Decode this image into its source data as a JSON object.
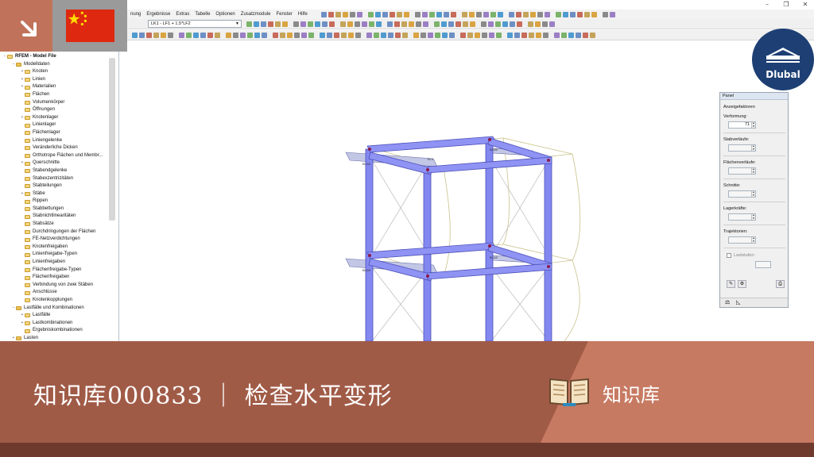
{
  "window": {
    "controls": [
      "–",
      "❐",
      "✕"
    ]
  },
  "menu": {
    "items": [
      "nung",
      "Ergebnisse",
      "Extras",
      "Tabelle",
      "Optionen",
      "Zusatzmodule",
      "Fenster",
      "Hilfe"
    ]
  },
  "toolbar": {
    "load_combo_value": "LK1 - LF1 + 1.5*LF2"
  },
  "navigator": {
    "root": "RFEM - Model File",
    "items": [
      {
        "label": "Modelldaten",
        "level": 1,
        "expand": "−"
      },
      {
        "label": "Knoten",
        "level": 2,
        "expand": "+"
      },
      {
        "label": "Linien",
        "level": 2,
        "expand": "+"
      },
      {
        "label": "Materialien",
        "level": 2,
        "expand": "+"
      },
      {
        "label": "Flächen",
        "level": 2,
        "expand": ""
      },
      {
        "label": "Volumenkörper",
        "level": 2,
        "expand": ""
      },
      {
        "label": "Öffnungen",
        "level": 2,
        "expand": ""
      },
      {
        "label": "Knotenlager",
        "level": 2,
        "expand": "+"
      },
      {
        "label": "Linienlager",
        "level": 2,
        "expand": ""
      },
      {
        "label": "Flächenlager",
        "level": 2,
        "expand": ""
      },
      {
        "label": "Liniengelenke",
        "level": 2,
        "expand": ""
      },
      {
        "label": "Veränderliche Dicken",
        "level": 2,
        "expand": ""
      },
      {
        "label": "Orthotrope Flächen und Membr...",
        "level": 2,
        "expand": ""
      },
      {
        "label": "Querschnitte",
        "level": 2,
        "expand": "+"
      },
      {
        "label": "Stabendgelenke",
        "level": 2,
        "expand": ""
      },
      {
        "label": "Stabexzentrizitäten",
        "level": 2,
        "expand": ""
      },
      {
        "label": "Stabteilungen",
        "level": 2,
        "expand": ""
      },
      {
        "label": "Stäbe",
        "level": 2,
        "expand": "+"
      },
      {
        "label": "Rippen",
        "level": 2,
        "expand": ""
      },
      {
        "label": "Stabbettungen",
        "level": 2,
        "expand": ""
      },
      {
        "label": "Stabnichtlinearitäten",
        "level": 2,
        "expand": ""
      },
      {
        "label": "Stabsätze",
        "level": 2,
        "expand": ""
      },
      {
        "label": "Durchdringungen der Flächen",
        "level": 2,
        "expand": ""
      },
      {
        "label": "FE-Netzverdichtungen",
        "level": 2,
        "expand": ""
      },
      {
        "label": "Knotenfreigaben",
        "level": 2,
        "expand": ""
      },
      {
        "label": "Linienfreigabe-Typen",
        "level": 2,
        "expand": ""
      },
      {
        "label": "Linienfreigaben",
        "level": 2,
        "expand": ""
      },
      {
        "label": "Flächenfreigabe-Typen",
        "level": 2,
        "expand": ""
      },
      {
        "label": "Flächenfreigaben",
        "level": 2,
        "expand": ""
      },
      {
        "label": "Verbindung von zwei Stäben",
        "level": 2,
        "expand": ""
      },
      {
        "label": "Anschlüsse",
        "level": 2,
        "expand": ""
      },
      {
        "label": "Knotenkopplungen",
        "level": 2,
        "expand": ""
      },
      {
        "label": "Lastfälle und Kombinationen",
        "level": 1,
        "expand": "−"
      },
      {
        "label": "Lastfälle",
        "level": 2,
        "expand": "+"
      },
      {
        "label": "Lastkombinationen",
        "level": 2,
        "expand": "+"
      },
      {
        "label": "Ergebniskombinationen",
        "level": 2,
        "expand": ""
      },
      {
        "label": "Lasten",
        "level": 1,
        "expand": "+"
      }
    ]
  },
  "panel": {
    "title": "Panel",
    "section": "Anzeigefaktoren",
    "deformation_label": "Verformung:",
    "deformation_value": "71",
    "stab_label": "Stabverläufe:",
    "flaechen_label": "Flächenverläufe:",
    "schnitte_label": "Schnitte:",
    "lager_label": "Lagerkräfte:",
    "trajektorien_label": "Trajektorien:",
    "laststufen_label": "Laststufen:"
  },
  "model": {
    "annotation_top": "Bl.4",
    "node_labels": [
      "Bl.4/0",
      "Bl.4/0",
      "Bl.4/0",
      "Bl.4/0"
    ]
  },
  "logo": {
    "text": "Dlubal"
  },
  "banner": {
    "title": "知识库000833 ｜ 检查水平变形",
    "category": "知识库"
  },
  "colors": {
    "banner_left": "#a05b47",
    "banner_right": "#c77a62",
    "bottom_strip": "#6e3a2e",
    "dlubal_blue": "#1d3f74",
    "member_blue": "#7f83f2",
    "flag_red": "#de2910",
    "flag_star": "#ffde00"
  }
}
